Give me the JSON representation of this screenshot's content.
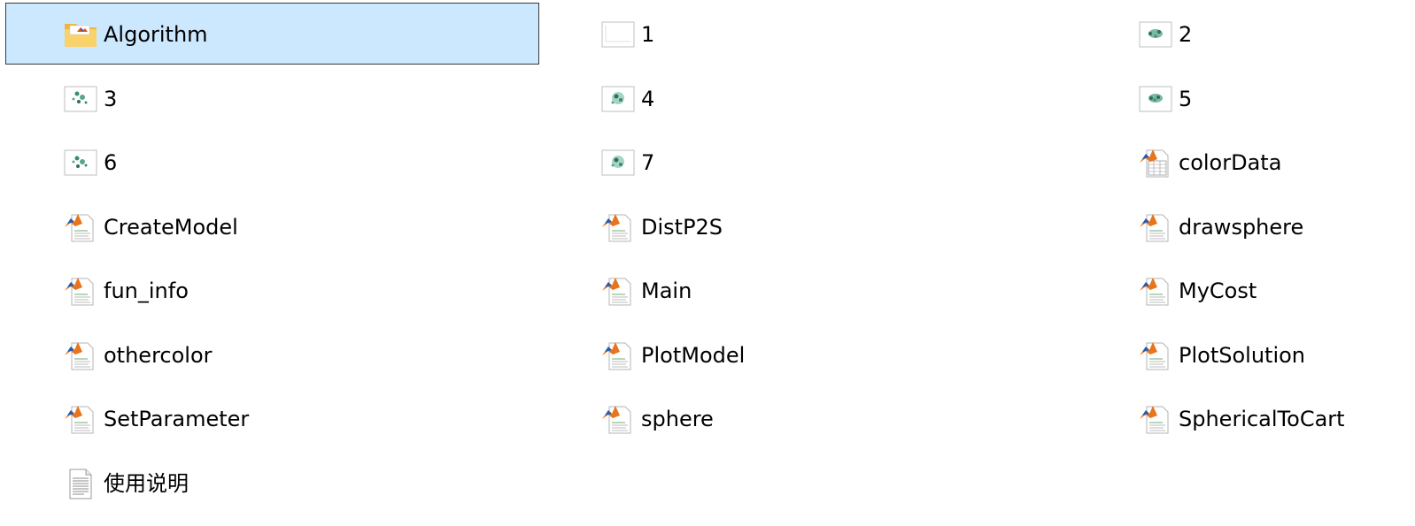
{
  "files": [
    {
      "label": "Algorithm",
      "icon": "folder-icon"
    },
    {
      "label": "1",
      "icon": "image-file-icon"
    },
    {
      "label": "2",
      "icon": "image-file-icon"
    },
    {
      "label": "3",
      "icon": "image-file-icon"
    },
    {
      "label": "4",
      "icon": "image-file-icon"
    },
    {
      "label": "5",
      "icon": "image-file-icon"
    },
    {
      "label": "6",
      "icon": "image-file-icon"
    },
    {
      "label": "7",
      "icon": "image-file-icon"
    },
    {
      "label": "colorData",
      "icon": "matlab-data-file-icon"
    },
    {
      "label": "CreateModel",
      "icon": "matlab-file-icon"
    },
    {
      "label": "DistP2S",
      "icon": "matlab-file-icon"
    },
    {
      "label": "drawsphere",
      "icon": "matlab-file-icon"
    },
    {
      "label": "fun_info",
      "icon": "matlab-file-icon"
    },
    {
      "label": "Main",
      "icon": "matlab-file-icon"
    },
    {
      "label": "MyCost",
      "icon": "matlab-file-icon"
    },
    {
      "label": "othercolor",
      "icon": "matlab-file-icon"
    },
    {
      "label": "PlotModel",
      "icon": "matlab-file-icon"
    },
    {
      "label": "PlotSolution",
      "icon": "matlab-file-icon"
    },
    {
      "label": "SetParameter",
      "icon": "matlab-file-icon"
    },
    {
      "label": "sphere",
      "icon": "matlab-file-icon"
    },
    {
      "label": "SphericalToCart",
      "icon": "matlab-file-icon"
    },
    {
      "label": "使用说明",
      "icon": "text-file-icon"
    }
  ],
  "selected_item": "Algorithm",
  "colors": {
    "selection_background": "#cce8ff",
    "selection_border": "#3a3a3a",
    "folder_yellow": "#f7c54a",
    "matlab_orange": "#e8741e"
  }
}
